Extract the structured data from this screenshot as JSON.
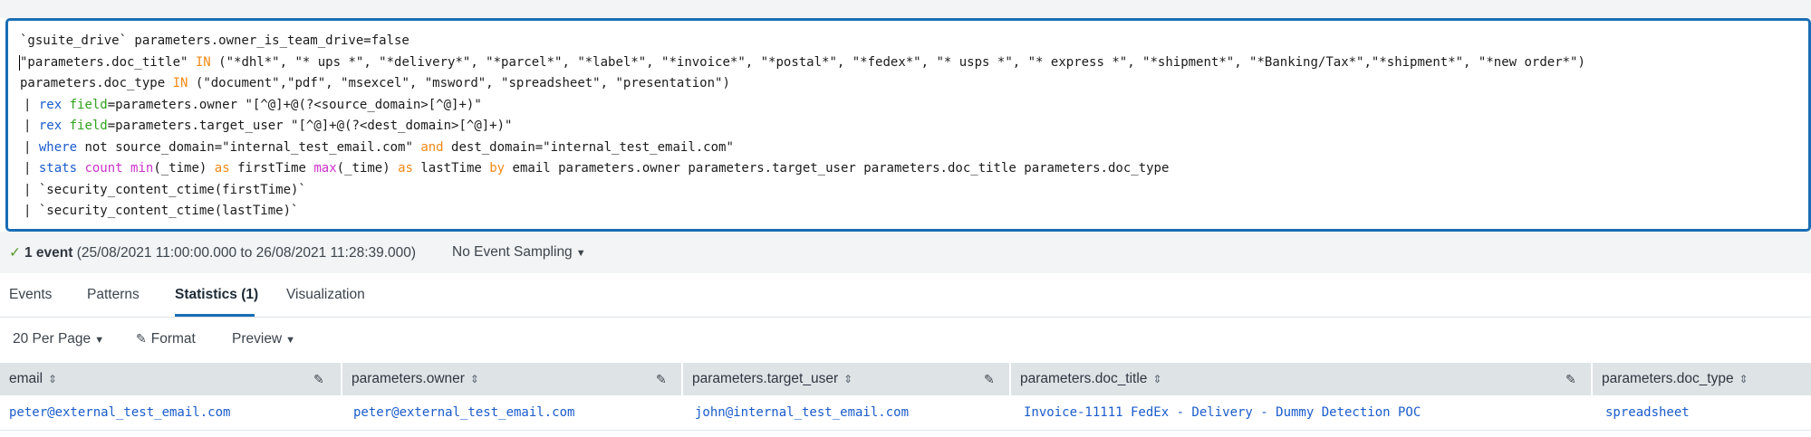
{
  "query": {
    "line1": "`gsuite_drive` parameters.owner_is_team_drive=false",
    "line2": {
      "field": "\"parameters.doc_title\"",
      "op": "IN",
      "values": "(\"*dhl*\", \"* ups *\", \"*delivery*\", \"*parcel*\", \"*label*\", \"*invoice*\", \"*postal*\", \"*fedex*\", \"* usps *\", \"* express *\", \"*shipment*\", \"*Banking/Tax*\",\"*shipment*\", \"*new order*\")"
    },
    "line3": {
      "field": "parameters.doc_type",
      "op": "IN",
      "values": "(\"document\",\"pdf\", \"msexcel\", \"msword\", \"spreadsheet\", \"presentation\")"
    },
    "line4": {
      "pipe": "| ",
      "cmd": "rex",
      "arg": "field",
      "rest": "=parameters.owner \"[^@]+@(?<source_domain>[^@]+)\""
    },
    "line5": {
      "pipe": "| ",
      "cmd": "rex",
      "arg": "field",
      "rest": "=parameters.target_user \"[^@]+@(?<dest_domain>[^@]+)\""
    },
    "line6": {
      "pipe": "| ",
      "cmd": "where",
      "part1": " not source_domain=\"internal_test_email.com\" ",
      "op": "and",
      "part2": " dest_domain=\"internal_test_email.com\""
    },
    "line7": {
      "pipe": "| ",
      "cmd": "stats",
      "f1": "count",
      "f2": "min",
      "a1": "(_time) ",
      "as1": "as",
      "b1": " firstTime ",
      "f3": "max",
      "a2": "(_time) ",
      "as2": "as",
      "b2": " lastTime ",
      "by": "by",
      "c": " email parameters.owner parameters.target_user parameters.doc_title parameters.doc_type"
    },
    "line8": "| `security_content_ctime(firstTime)`",
    "line9": "| `security_content_ctime(lastTime)`"
  },
  "status": {
    "check": "✓",
    "count": "1 event",
    "range": "(25/08/2021 11:00:00.000 to 26/08/2021 11:28:39.000)",
    "sampling": "No Event Sampling"
  },
  "tabs": [
    "Events",
    "Patterns",
    "Statistics (1)",
    "Visualization"
  ],
  "toolbar": {
    "per_page": "20 Per Page",
    "format": "Format",
    "preview": "Preview"
  },
  "table": {
    "columns": [
      "email",
      "parameters.owner",
      "parameters.target_user",
      "parameters.doc_title",
      "parameters.doc_type"
    ],
    "rows": [
      [
        "peter@external_test_email.com",
        "peter@external_test_email.com",
        "john@internal_test_email.com",
        "Invoice-11111 FedEx - Delivery - Dummy Detection POC",
        "spreadsheet"
      ]
    ]
  },
  "colors": {
    "accent": "#1a6eb5",
    "keyword_orange": "#f28a17",
    "keyword_blue": "#1a5ccc",
    "keyword_green": "#31a31d",
    "keyword_pink": "#cc33cc",
    "link": "#1a5ccc"
  }
}
